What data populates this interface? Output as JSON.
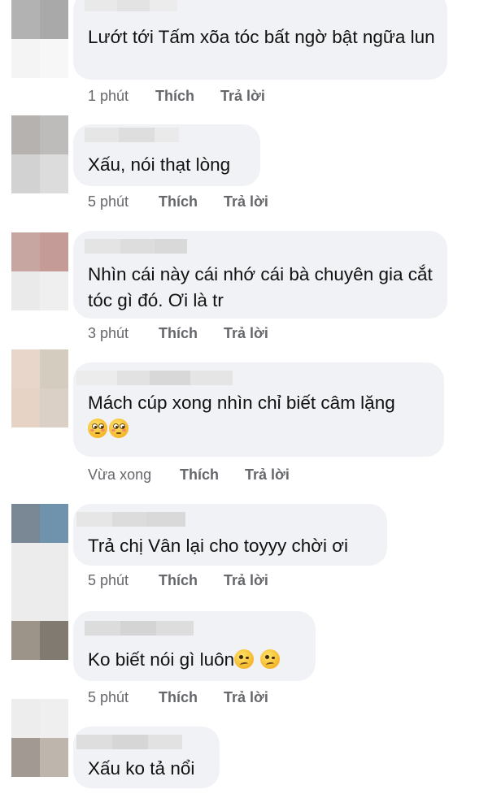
{
  "comments": [
    {
      "text": "Lướt tới Tấm xõa tóc bất ngờ bật ngữa lun",
      "time": "1 phút",
      "like": "Thích",
      "reply": "Trả lời",
      "avatar": [
        "#b2b2b2",
        "#a9a9a9",
        "#f4f4f4",
        "#f7f7f7"
      ]
    },
    {
      "text": "Xấu, nói thạt lòng",
      "time": "5 phút",
      "like": "Thích",
      "reply": "Trả lời",
      "avatar": [
        "#b5b2b0",
        "#bdbcba",
        "#d2d2d2",
        "#dcdcdc"
      ]
    },
    {
      "text": "Nhìn cái này cái nhớ cái bà chuyên gia cắt tóc gì đó. Ơi là tr",
      "time": "3 phút",
      "like": "Thích",
      "reply": "Trả lời",
      "avatar": [
        "#c7a5a0",
        "#c49b96",
        "#eaeaea",
        "#efefef"
      ]
    },
    {
      "text": "Mách cúp xong nhìn chỉ biết câm lặng",
      "emoji": [
        "flushed-face-emoji",
        "flushed-face-emoji"
      ],
      "time": "Vừa xong",
      "like": "Thích",
      "reply": "Trả lời",
      "avatar": [
        "#e7d6c9",
        "#d5ccc0",
        "#e6d3c6",
        "#dad0c6"
      ]
    },
    {
      "text": "Trả chị Vân lại cho toyyy chời ơi",
      "time": "5 phút",
      "like": "Thích",
      "reply": "Trả lời",
      "avatar": [
        "#7a8794",
        "#6f93ad",
        "#ececec",
        "#ececec"
      ]
    },
    {
      "text": "Ko biết nói gì luôn",
      "emoji": [
        "woozy-face-emoji",
        "woozy-face-emoji"
      ],
      "time": "5 phút",
      "like": "Thích",
      "reply": "Trả lời",
      "avatar": [
        "#9c9488",
        "#817a71",
        "#eeeeee",
        "#eeeeee"
      ]
    },
    {
      "text": "Xấu ko tả nổi",
      "time": "",
      "like": "",
      "reply": "",
      "avatar": [
        "#ededed",
        "#efefef",
        "#a29a92",
        "#beb6ad"
      ]
    }
  ],
  "colors": {
    "bubble": "#f0f2f5",
    "meta": "#65676b",
    "text": "#050505",
    "name_placeholder": "#d9d9d9"
  }
}
